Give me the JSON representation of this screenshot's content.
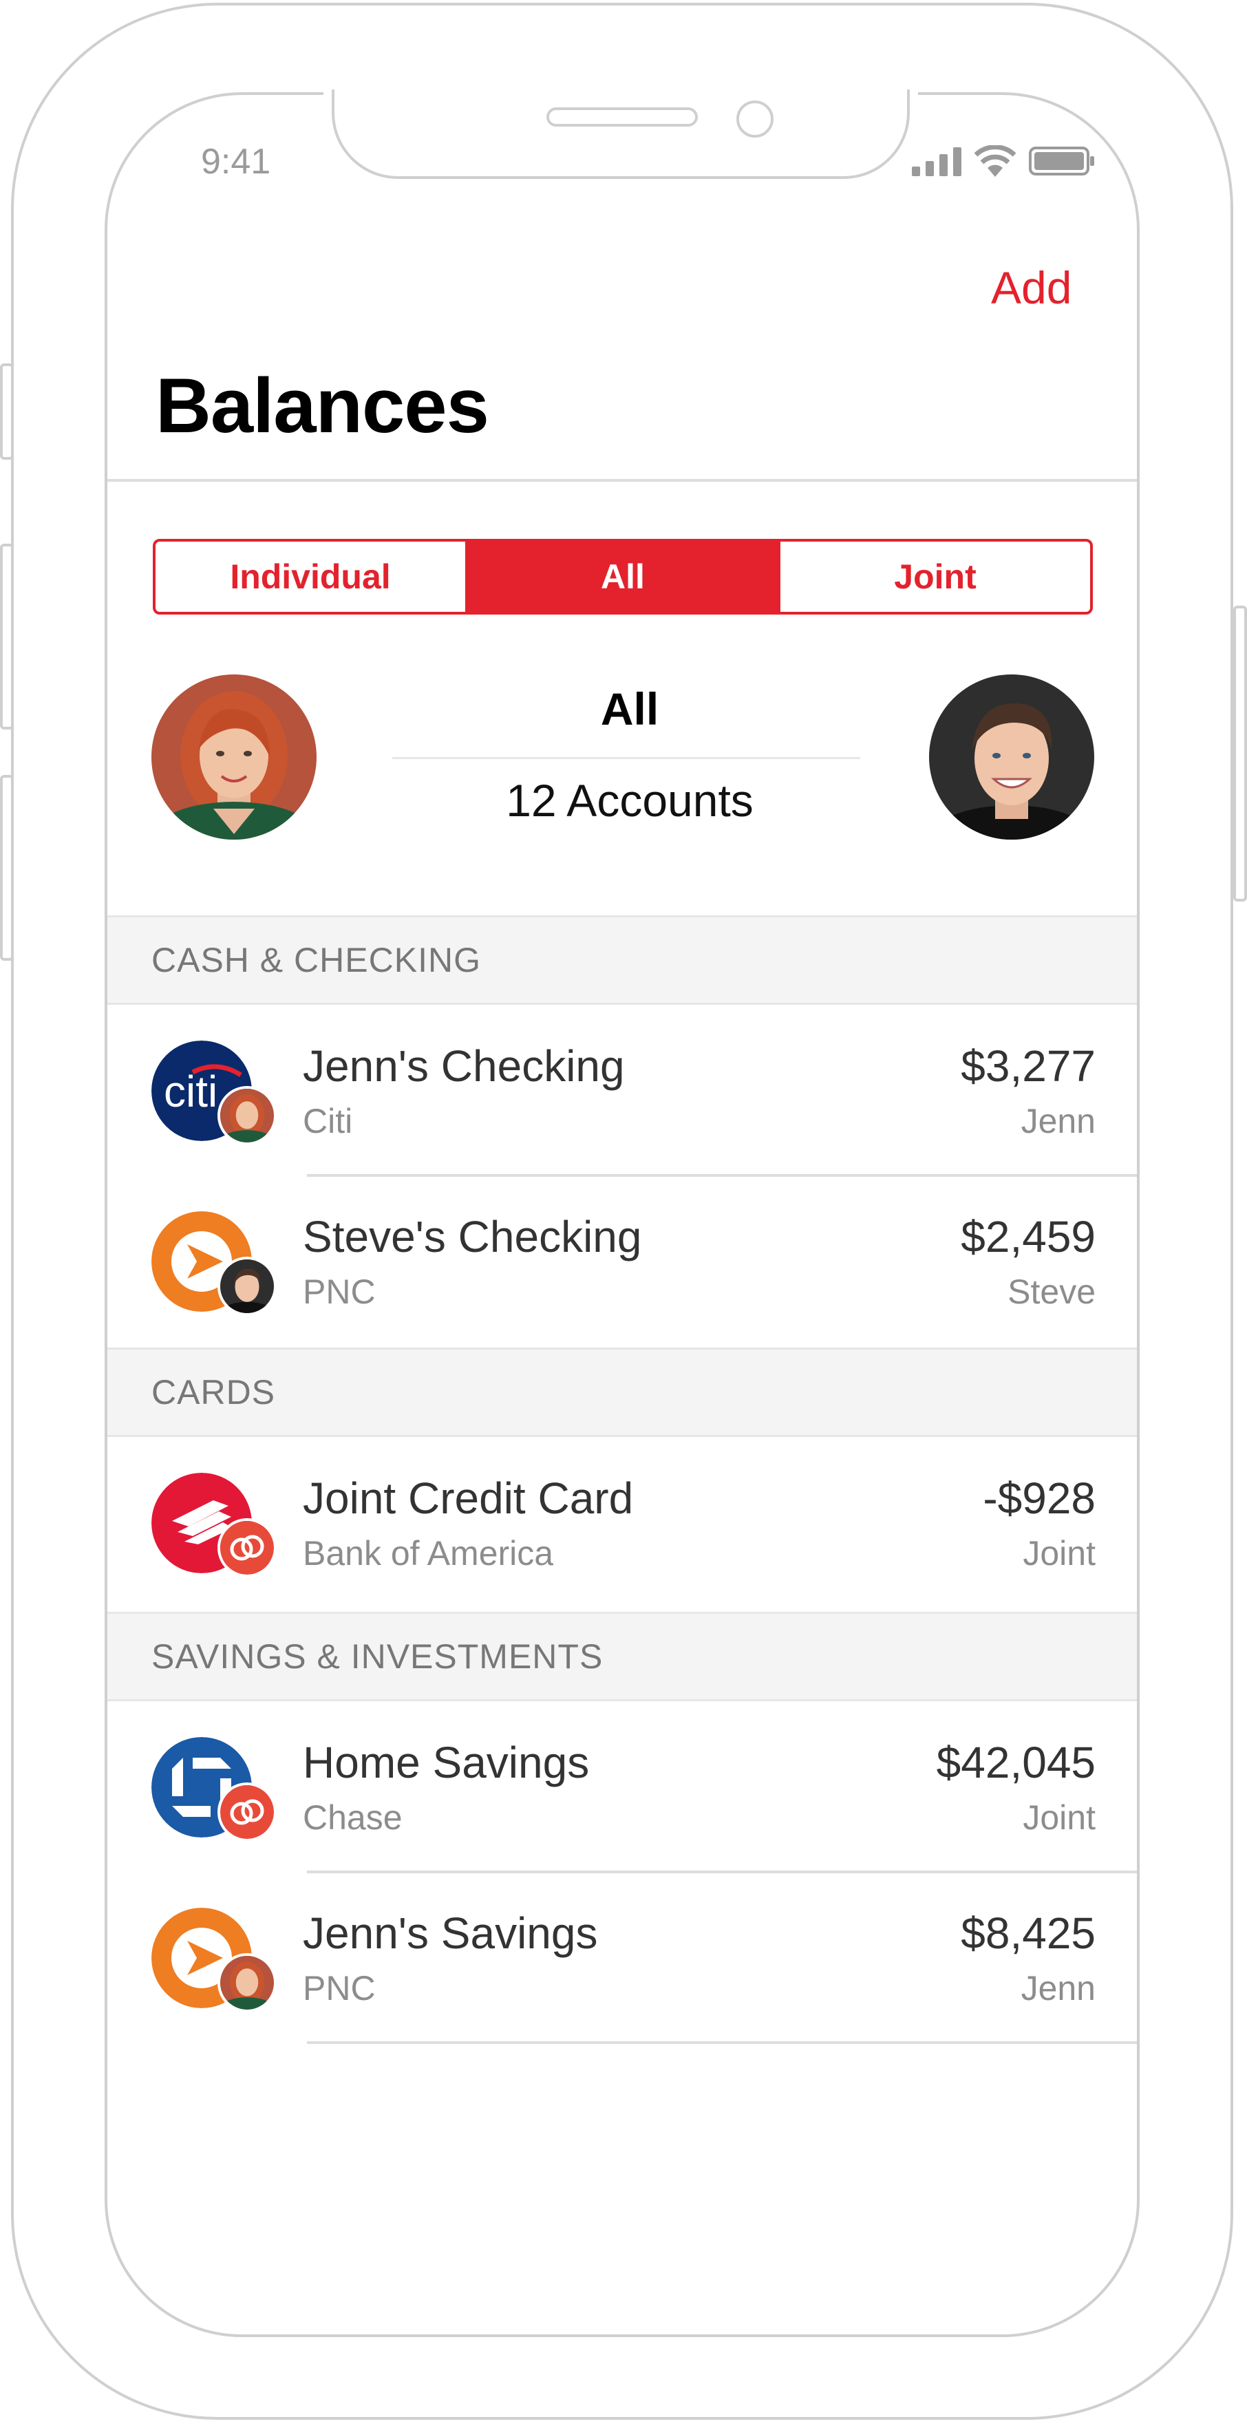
{
  "status_bar": {
    "time": "9:41"
  },
  "header": {
    "add_label": "Add",
    "title": "Balances"
  },
  "segments": [
    {
      "label": "Individual",
      "active": false
    },
    {
      "label": "All",
      "active": true
    },
    {
      "label": "Joint",
      "active": false
    }
  ],
  "summary": {
    "title": "All",
    "count": "12 Accounts"
  },
  "sections": [
    {
      "title": "CASH & CHECKING",
      "accounts": [
        {
          "name": "Jenn's Checking",
          "bank": "Citi",
          "amount": "$3,277",
          "owner": "Jenn",
          "bank_icon": "citi-logo-icon",
          "owner_icon": "jenn-avatar"
        },
        {
          "name": "Steve's Checking",
          "bank": "PNC",
          "amount": "$2,459",
          "owner": "Steve",
          "bank_icon": "pnc-logo-icon",
          "owner_icon": "steve-avatar"
        }
      ]
    },
    {
      "title": "CARDS",
      "accounts": [
        {
          "name": "Joint Credit Card",
          "bank": "Bank of America",
          "amount": "-$928",
          "owner": "Joint",
          "bank_icon": "bank-of-america-logo-icon",
          "owner_icon": "joint-rings-icon"
        }
      ]
    },
    {
      "title": "SAVINGS & INVESTMENTS",
      "accounts": [
        {
          "name": "Home Savings",
          "bank": "Chase",
          "amount": "$42,045",
          "owner": "Joint",
          "bank_icon": "chase-logo-icon",
          "owner_icon": "joint-rings-icon"
        },
        {
          "name": "Jenn's Savings",
          "bank": "PNC",
          "amount": "$8,425",
          "owner": "Jenn",
          "bank_icon": "pnc-logo-icon",
          "owner_icon": "jenn-avatar"
        }
      ]
    }
  ],
  "colors": {
    "accent": "#e3222d",
    "citi": "#0a2a6b",
    "pnc": "#ef7d22",
    "boa": "#e31837",
    "chase": "#1a5aa7"
  }
}
